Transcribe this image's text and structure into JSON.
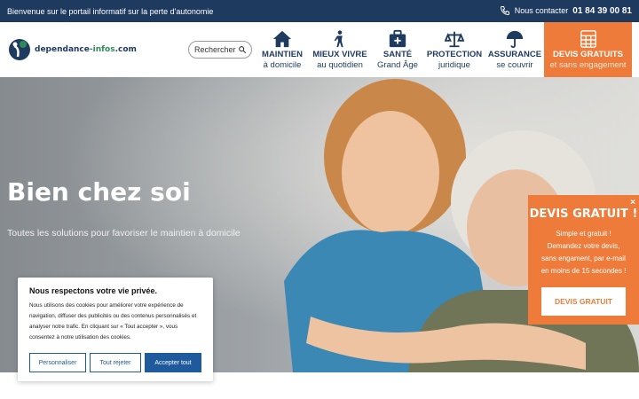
{
  "topbar": {
    "welcome": "Bienvenue sur le portail informatif sur la perte d'autonomie",
    "contact_label": "Nous contacter",
    "phone": "01 84 39 00 81"
  },
  "logo": {
    "name_part1": "dependance",
    "name_part2": "-infos",
    "name_part3": ".com"
  },
  "search": {
    "placeholder": "Rechercher"
  },
  "nav": [
    {
      "l1": "MAINTIEN",
      "l2": "à domicile",
      "icon": "house-icon"
    },
    {
      "l1": "MIEUX VIVRE",
      "l2": "au quotidien",
      "icon": "person-walking-icon"
    },
    {
      "l1": "SANTÉ",
      "l2": "Grand Âge",
      "icon": "medical-kit-icon"
    },
    {
      "l1": "PROTECTION",
      "l2": "juridique",
      "icon": "scales-icon"
    },
    {
      "l1": "ASSURANCE",
      "l2": "se couvrir",
      "icon": "umbrella-icon"
    },
    {
      "l1": "DEVIS GRATUITS",
      "l2": "et sans engagement",
      "icon": "calculator-icon"
    }
  ],
  "hero": {
    "title": "Bien chez soi",
    "subtitle": "Toutes les solutions pour favoriser le maintien à domicile"
  },
  "cookie": {
    "title": "Nous respectons votre vie privée.",
    "body": "Nous utilisons des cookies pour améliorer votre expérience de navigation, diffuser des publicités ou des contenus personnalisés et analyser notre trafic. En cliquant sur « Tout accepter », vous consentez à notre utilisation des cookies.",
    "customize": "Personnaliser",
    "reject": "Tout rejeter",
    "accept": "Accepter tout"
  },
  "devis_popup": {
    "title": "DEVIS GRATUIT !",
    "l1": "Simple et gratuit !",
    "l2": "Demandez votre devis,",
    "l3": "sans engament, par e-mail",
    "l4": "en moins de 15 secondes !",
    "button": "DEVIS GRATUIT",
    "close": "×"
  },
  "colors": {
    "navy": "#1e3a5f",
    "orange": "#ef7b3a",
    "cookie_blue": "#1e5a9c"
  }
}
